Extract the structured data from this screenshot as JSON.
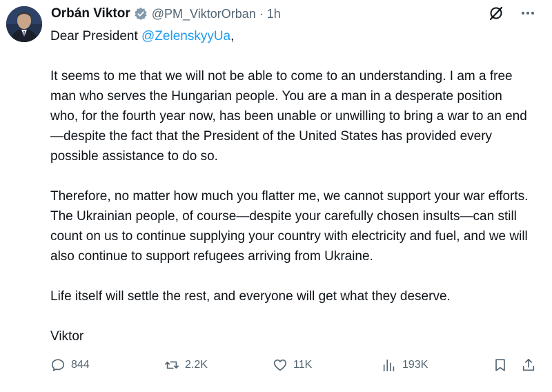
{
  "tweet": {
    "author": {
      "name": "Orbán Viktor",
      "handle": "@PM_ViktorOrban",
      "separator": "·",
      "time": "1h",
      "verified_color": "#829aab"
    },
    "greeting_prefix": "Dear President ",
    "greeting_mention": "@ZelenskyyUa",
    "greeting_suffix": ",",
    "paragraphs": [
      "It seems to me that we will not be able to come to an understanding. I am a free man who serves the Hungarian people. You are a man in a desperate position who, for the fourth year now, has been unable or unwilling to bring a war to an end—despite the fact that the President of the United States has provided every possible assistance to do so.",
      "Therefore, no matter how much you flatter me, we cannot support your war efforts. The Ukrainian people, of course—despite your carefully chosen insults—can still count on us to continue supplying your country with electricity and fuel, and we will also continue to support refugees arriving from Ukraine.",
      "Life itself will settle the rest, and everyone will get what they deserve.",
      "Viktor"
    ],
    "stats": {
      "replies": "844",
      "reposts": "2.2K",
      "likes": "11K",
      "views": "193K"
    },
    "icons": {
      "reply": "speech-bubble-icon",
      "repost": "repost-arrows-icon",
      "like": "heart-icon",
      "views": "bar-chart-icon",
      "bookmark": "bookmark-icon",
      "share": "share-upload-icon",
      "grok": "grok-slash-icon",
      "more": "ellipsis-icon"
    },
    "colors": {
      "text": "#0f1419",
      "secondary": "#536471",
      "link": "#1d9bf0"
    }
  }
}
